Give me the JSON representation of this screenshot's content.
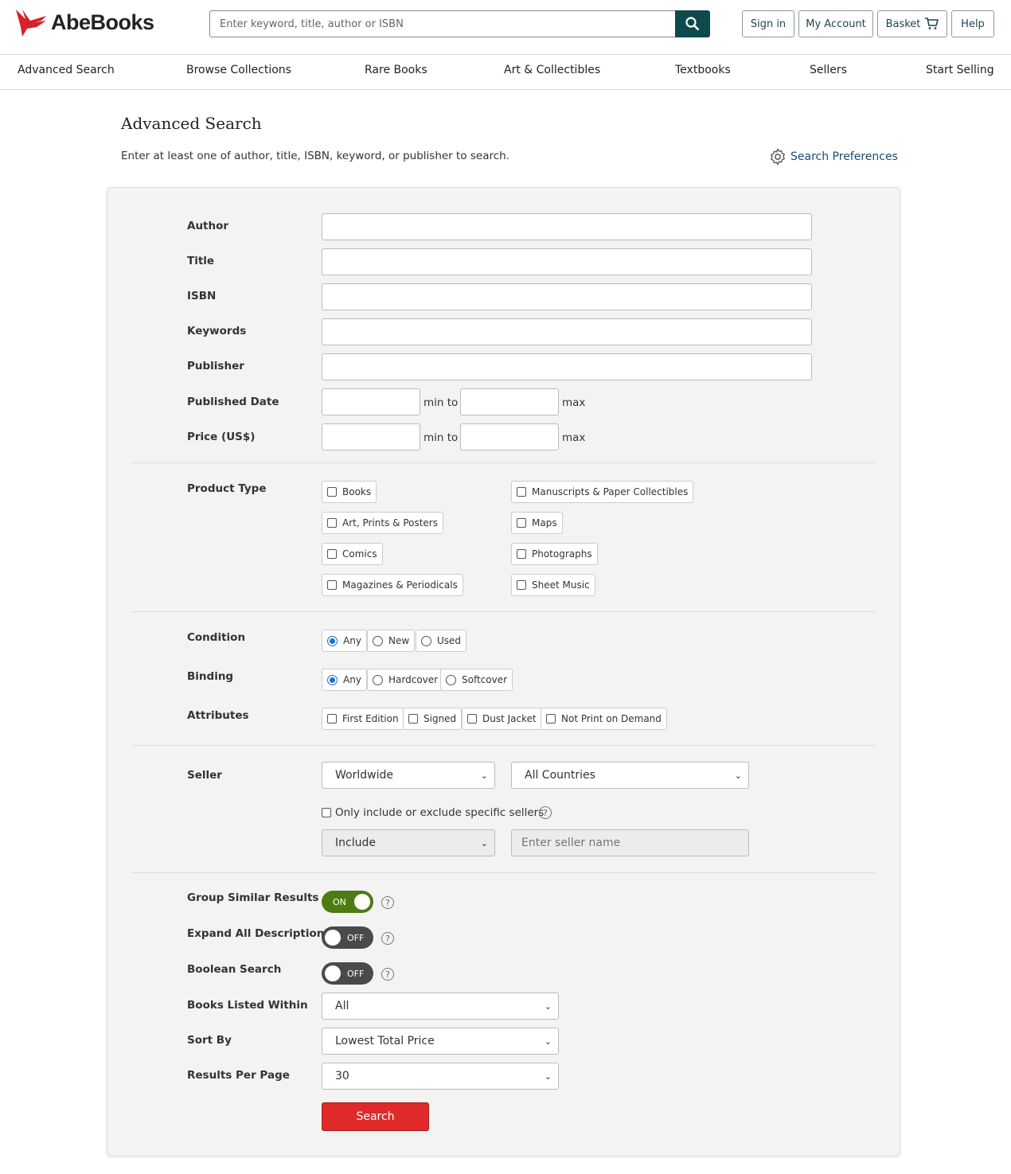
{
  "header": {
    "logo": "AbeBooks",
    "search_placeholder": "Enter keyword, title, author or ISBN",
    "sign_in": "Sign in",
    "my_account": "My Account",
    "basket": "Basket",
    "help": "Help"
  },
  "nav": [
    "Advanced Search",
    "Browse Collections",
    "Rare Books",
    "Art & Collectibles",
    "Textbooks",
    "Sellers",
    "Start Selling"
  ],
  "page": {
    "title": "Advanced Search",
    "subtitle": "Enter at least one of author, title, ISBN, keyword, or publisher to search.",
    "preferences": "Search Preferences"
  },
  "fields": {
    "author": "Author",
    "title": "Title",
    "isbn": "ISBN",
    "keywords": "Keywords",
    "publisher": "Publisher",
    "published_date": "Published Date",
    "price": "Price (US$)",
    "min_to": "min to",
    "max": "max"
  },
  "product_type": {
    "label": "Product Type",
    "col1": [
      "Books",
      "Art, Prints & Posters",
      "Comics",
      "Magazines & Periodicals"
    ],
    "col2": [
      "Manuscripts & Paper Collectibles",
      "Maps",
      "Photographs",
      "Sheet Music"
    ]
  },
  "condition": {
    "label": "Condition",
    "options": [
      "Any",
      "New",
      "Used"
    ],
    "selected": "Any"
  },
  "binding": {
    "label": "Binding",
    "options": [
      "Any",
      "Hardcover",
      "Softcover"
    ],
    "selected": "Any"
  },
  "attributes": {
    "label": "Attributes",
    "options": [
      "First Edition",
      "Signed",
      "Dust Jacket",
      "Not Print on Demand"
    ]
  },
  "seller": {
    "label": "Seller",
    "region": "Worldwide",
    "country": "All Countries",
    "specific_label": "Only include or exclude specific sellers",
    "mode": "Include",
    "name_placeholder": "Enter seller name"
  },
  "toggles": [
    {
      "label": "Group Similar Results",
      "state": "ON"
    },
    {
      "label": "Expand All Descriptions",
      "state": "OFF"
    },
    {
      "label": "Boolean Search",
      "state": "OFF"
    }
  ],
  "listed_within": {
    "label": "Books Listed Within",
    "value": "All"
  },
  "sort_by": {
    "label": "Sort By",
    "value": "Lowest Total Price"
  },
  "per_page": {
    "label": "Results Per Page",
    "value": "30"
  },
  "search_button": "Search",
  "colors": {
    "brand_red": "#d3222a",
    "search_button": "#e02a2a",
    "toggle_on": "#4c7c12",
    "header_search": "#0e4a4d"
  }
}
